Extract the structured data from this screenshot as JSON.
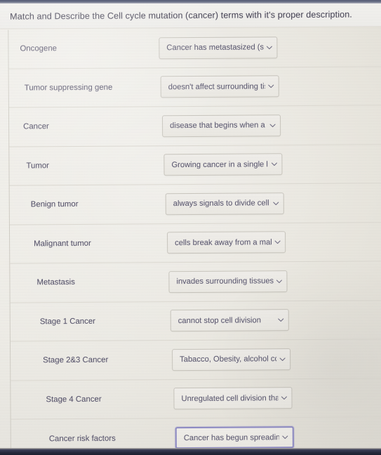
{
  "header": {
    "prompt": "Match and Describe the Cell cycle mutation (cancer) terms with it's proper description."
  },
  "colors": {
    "page_background": "#eae8e1",
    "card_background": "#efede7",
    "text": "#55526a",
    "row_divider": "#dcd9d1",
    "select_border": "#c8c5bd",
    "focus_border": "#8e8bc4",
    "bezel_top": "#6d7389",
    "bezel_bottom": "#242639"
  },
  "rows": [
    {
      "term": "Oncogene",
      "selected": "Cancer has metastasized (spre",
      "focused": false,
      "caret_icon": "chevron-down-icon"
    },
    {
      "term": "Tumor suppressing gene",
      "selected": "doesn't affect surrounding tiss",
      "focused": false,
      "caret_icon": "chevron-down-icon"
    },
    {
      "term": "Cancer",
      "selected": "disease that begins when a sir",
      "focused": false,
      "caret_icon": "chevron-down-icon"
    },
    {
      "term": "Tumor",
      "selected": "Growing cancer in a single lun",
      "focused": false,
      "caret_icon": "chevron-down-icon"
    },
    {
      "term": "Benign tumor",
      "selected": "always signals to divide cell",
      "focused": false,
      "caret_icon": "chevron-down-icon"
    },
    {
      "term": "Malignant tumor",
      "selected": "cells break away from a maligr",
      "focused": false,
      "caret_icon": "chevron-down-icon"
    },
    {
      "term": "Metastasis",
      "selected": "invades surrounding tissues; c",
      "focused": false,
      "caret_icon": "chevron-down-icon"
    },
    {
      "term": "Stage 1 Cancer",
      "selected": "cannot stop cell division",
      "focused": false,
      "caret_icon": "chevron-down-icon"
    },
    {
      "term": "Stage 2&3 Cancer",
      "selected": "Tabacco, Obesity, alcohol con",
      "focused": false,
      "caret_icon": "chevron-down-icon"
    },
    {
      "term": "Stage 4 Cancer",
      "selected": "Unregulated cell division that",
      "focused": false,
      "caret_icon": "chevron-down-icon"
    },
    {
      "term": "Cancer risk factors",
      "selected": "Cancer has begun spreading in",
      "focused": true,
      "caret_icon": "chevron-down-icon"
    }
  ]
}
